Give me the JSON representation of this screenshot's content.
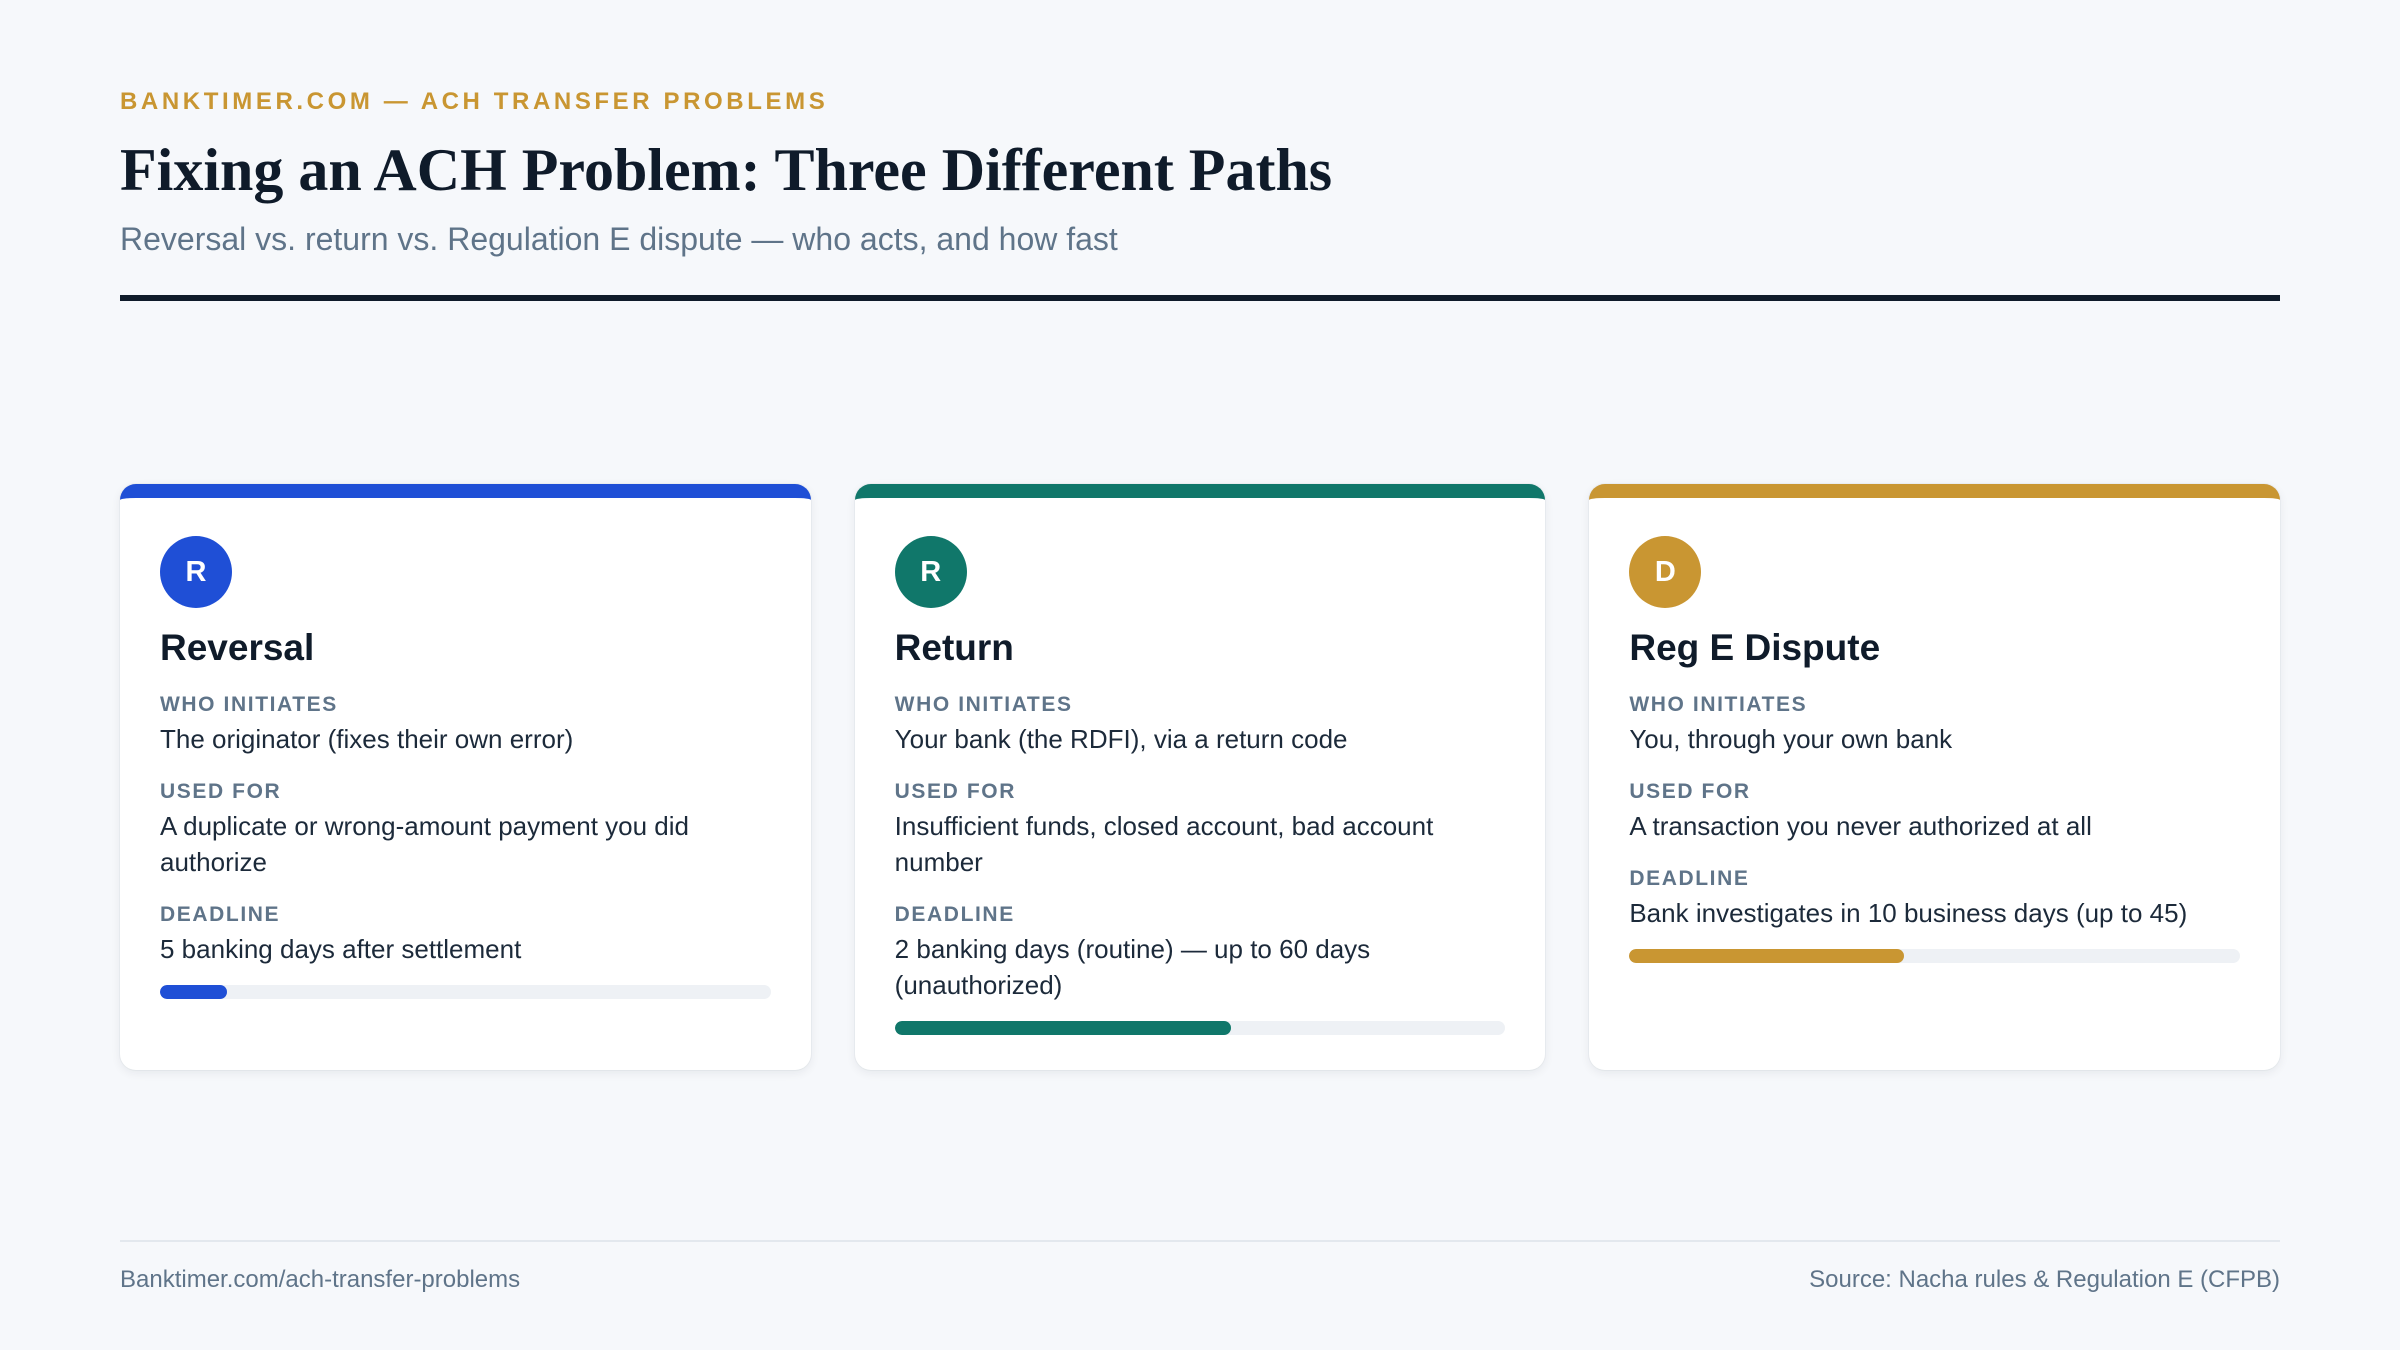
{
  "header": {
    "eyebrow": "BANKTIMER.COM — ACH TRANSFER PROBLEMS",
    "title": "Fixing an ACH Problem: Three Different Paths",
    "subtitle": "Reversal vs. return vs. Regulation E dispute — who acts, and how fast"
  },
  "colors": {
    "background": "#f6f8fb",
    "eyebrow": "#c99632",
    "ink": "#0f1b2a",
    "muted": "#5f7489"
  },
  "cards": [
    {
      "badge": "R",
      "title": "Reversal",
      "accent": "#1f4fd6",
      "fields": [
        {
          "label": "WHO INITIATES",
          "value": "The originator (fixes their own error)"
        },
        {
          "label": "USED FOR",
          "value": "A duplicate or wrong-amount payment you did authorize"
        },
        {
          "label": "DEADLINE",
          "value": "5 banking days after settlement"
        }
      ],
      "deadline_fill_percent": 11
    },
    {
      "badge": "R",
      "title": "Return",
      "accent": "#10776a",
      "fields": [
        {
          "label": "WHO INITIATES",
          "value": "Your bank (the RDFI), via a return code"
        },
        {
          "label": "USED FOR",
          "value": "Insufficient funds, closed account, bad account number"
        },
        {
          "label": "DEADLINE",
          "value": "2 banking days (routine) — up to 60 days (unauthorized)"
        }
      ],
      "deadline_fill_percent": 55
    },
    {
      "badge": "D",
      "title": "Reg E Dispute",
      "accent": "#c99632",
      "fields": [
        {
          "label": "WHO INITIATES",
          "value": "You, through your own bank"
        },
        {
          "label": "USED FOR",
          "value": "A transaction you never authorized at all"
        },
        {
          "label": "DEADLINE",
          "value": "Bank investigates in 10 business days (up to 45)"
        }
      ],
      "deadline_fill_percent": 45
    }
  ],
  "footer": {
    "left": "Banktimer.com/ach-transfer-problems",
    "right": "Source: Nacha rules & Regulation E (CFPB)"
  }
}
